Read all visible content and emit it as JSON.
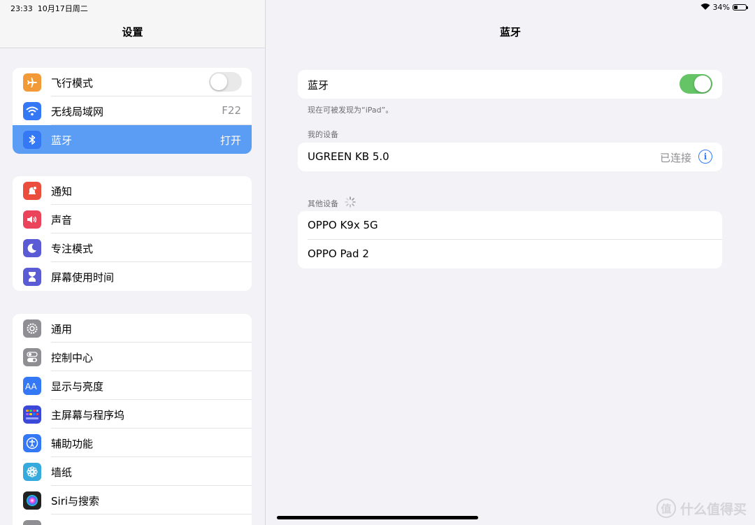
{
  "status_bar": {
    "time": "23:33",
    "date": "10月17日周二",
    "battery_percent": "34%",
    "battery_level": 0.34
  },
  "sidebar": {
    "title": "设置",
    "groups": [
      {
        "items": [
          {
            "label": "飞行模式",
            "icon": "airplane-icon",
            "color": "#f19a37",
            "toggle": "off"
          },
          {
            "label": "无线局域网",
            "icon": "wifi-icon",
            "color": "#3478f6",
            "value": "F22"
          },
          {
            "label": "蓝牙",
            "icon": "bluetooth-icon",
            "color": "#3478f6",
            "value": "打开",
            "selected": true
          }
        ]
      },
      {
        "items": [
          {
            "label": "通知",
            "icon": "notification-icon",
            "color": "#eb4e3d"
          },
          {
            "label": "声音",
            "icon": "speaker-icon",
            "color": "#eb445a"
          },
          {
            "label": "专注模式",
            "icon": "moon-icon",
            "color": "#5b5bd6"
          },
          {
            "label": "屏幕使用时间",
            "icon": "hourglass-icon",
            "color": "#5b5bd6"
          }
        ]
      },
      {
        "items": [
          {
            "label": "通用",
            "icon": "gear-icon",
            "color": "#8e8e93"
          },
          {
            "label": "控制中心",
            "icon": "switches-icon",
            "color": "#8e8e93"
          },
          {
            "label": "显示与亮度",
            "icon": "text-size-icon",
            "color": "#3478f6"
          },
          {
            "label": "主屏幕与程序坞",
            "icon": "grid-icon",
            "color": "#3b48d8"
          },
          {
            "label": "辅助功能",
            "icon": "accessibility-icon",
            "color": "#3478f6"
          },
          {
            "label": "墙纸",
            "icon": "flower-icon",
            "color": "#36aadc"
          },
          {
            "label": "Siri与搜索",
            "icon": "siri-icon",
            "color": "#222222"
          }
        ]
      }
    ]
  },
  "detail": {
    "title": "蓝牙",
    "bluetooth_toggle": {
      "label": "蓝牙",
      "state": "on"
    },
    "discoverable_note": "现在可被发现为“iPad”。",
    "my_devices_header": "我的设备",
    "my_devices": [
      {
        "name": "UGREEN KB 5.0",
        "status": "已连接"
      }
    ],
    "other_devices_header": "其他设备",
    "other_devices": [
      {
        "name": "OPPO K9x 5G"
      },
      {
        "name": "OPPO Pad 2"
      }
    ]
  },
  "watermark": {
    "badge": "值",
    "text": "什么值得买"
  }
}
